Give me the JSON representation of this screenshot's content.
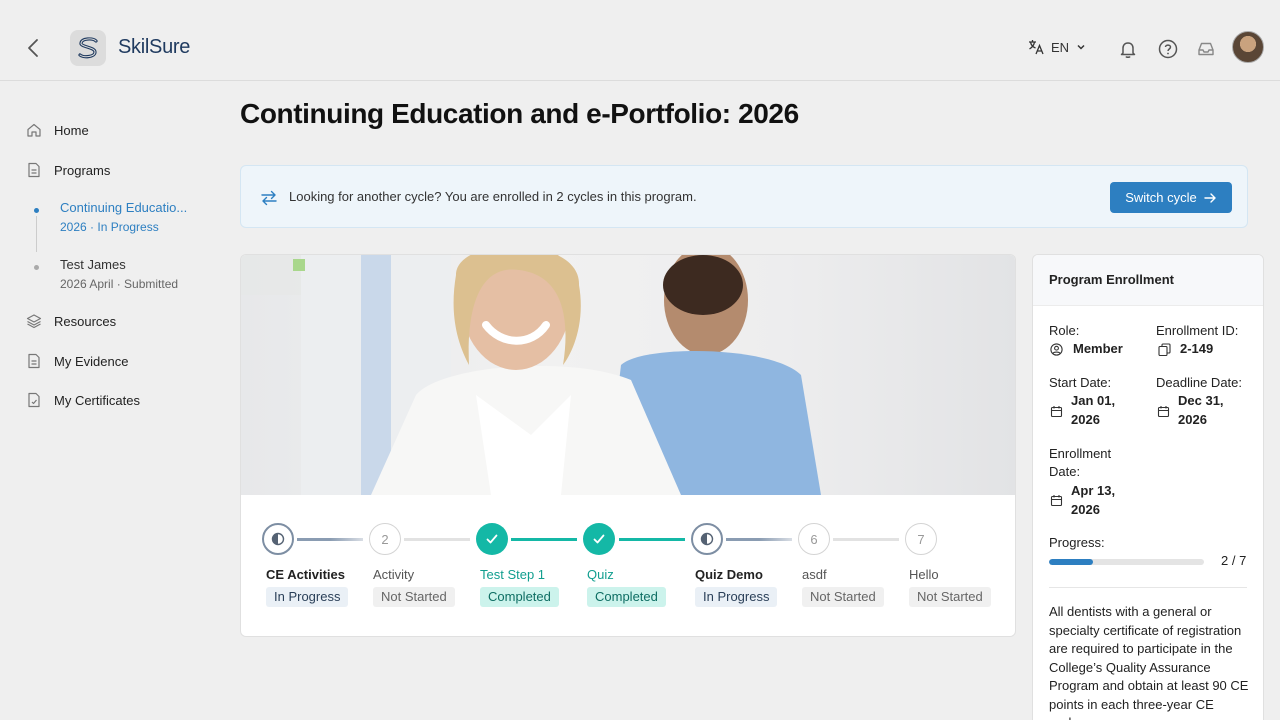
{
  "header": {
    "brand": "SkilSure",
    "language": "EN"
  },
  "sidebar": {
    "items": [
      {
        "label": "Home",
        "icon": "home-icon"
      },
      {
        "label": "Programs",
        "icon": "document-icon"
      },
      {
        "label": "Resources",
        "icon": "layers-icon"
      },
      {
        "label": "My Evidence",
        "icon": "document-icon"
      },
      {
        "label": "My Certificates",
        "icon": "certificate-icon"
      }
    ],
    "cycles": [
      {
        "title": "Continuing Educatio...",
        "meta": "2026 · In Progress",
        "active": true
      },
      {
        "title": "Test James",
        "meta": "2026 April · Submitted",
        "active": false
      }
    ]
  },
  "main": {
    "title": "Continuing Education and e-Portfolio: 2026",
    "banner": {
      "text": "Looking for another cycle? You are enrolled in 2 cycles in this program.",
      "button": "Switch cycle"
    },
    "steps": [
      {
        "num": "",
        "label": "CE Activities",
        "status": "In Progress",
        "state": "in-progress"
      },
      {
        "num": "2",
        "label": "Activity",
        "status": "Not Started",
        "state": "not-started"
      },
      {
        "num": "",
        "label": "Test Step 1",
        "status": "Completed",
        "state": "completed"
      },
      {
        "num": "",
        "label": "Quiz",
        "status": "Completed",
        "state": "completed"
      },
      {
        "num": "",
        "label": "Quiz Demo",
        "status": "In Progress",
        "state": "in-progress"
      },
      {
        "num": "6",
        "label": "asdf",
        "status": "Not Started",
        "state": "not-started"
      },
      {
        "num": "7",
        "label": "Hello",
        "status": "Not Started",
        "state": "not-started"
      }
    ]
  },
  "enrollment": {
    "title": "Program Enrollment",
    "role_label": "Role:",
    "role": "Member",
    "id_label": "Enrollment ID:",
    "id": "2-149",
    "start_label": "Start Date:",
    "start_line1": "Jan 01,",
    "start_line2": "2026",
    "deadline_label": "Deadline Date:",
    "deadline_line1": "Dec 31,",
    "deadline_line2": "2026",
    "enroll_label_1": "Enrollment",
    "enroll_label_2": "Date:",
    "enroll_line1": "Apr 13,",
    "enroll_line2": "2026",
    "progress_label": "Progress:",
    "progress_text": "2 / 7",
    "progress_fraction": 0.2857,
    "description": "All dentists with a general or specialty certificate of registration are required to participate in the College’s Quality Assurance Program and obtain at least 90 CE points in each three-year CE cycle."
  },
  "colors": {
    "accent": "#2d7fc1",
    "teal": "#14b8a6",
    "in_progress_badge": "#eaf0f6",
    "completed_badge": "#ccf3ec"
  }
}
